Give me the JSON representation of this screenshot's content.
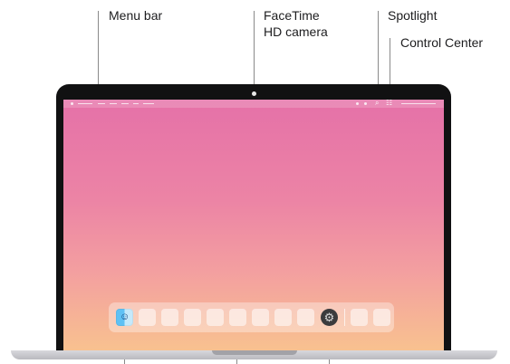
{
  "labels": {
    "menu_bar": "Menu bar",
    "facetime_line1": "FaceTime",
    "facetime_line2": "HD camera",
    "spotlight": "Spotlight",
    "control_center": "Control Center"
  },
  "colors": {
    "wallpaper_top": "#e571a8",
    "wallpaper_bottom": "#f8c28f",
    "bezel": "#111112",
    "callout_line": "#8a8a8a"
  },
  "icons": {
    "finder": "finder-icon",
    "system_settings": "gear-icon",
    "spotlight": "search-icon",
    "control_center": "control-center-icon"
  }
}
